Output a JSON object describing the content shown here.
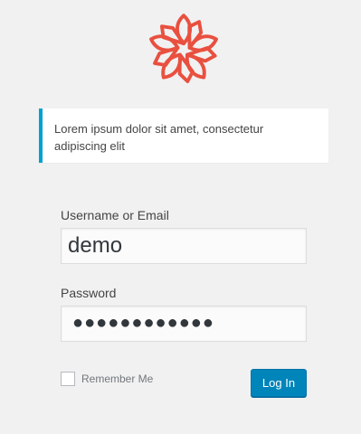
{
  "logo": {
    "icon": "flower-logo-icon",
    "color": "#e9503f"
  },
  "notice": {
    "text": "Lorem ipsum dolor sit amet, consectetur adipiscing elit",
    "accent": "#00a0d2"
  },
  "form": {
    "username_label": "Username or Email",
    "username_value": "demo",
    "password_label": "Password",
    "password_masked": "●●●●●●●●●●●●",
    "remember_label": "Remember Me",
    "remember_checked": false,
    "submit_label": "Log In",
    "submit_color": "#0085ba"
  }
}
